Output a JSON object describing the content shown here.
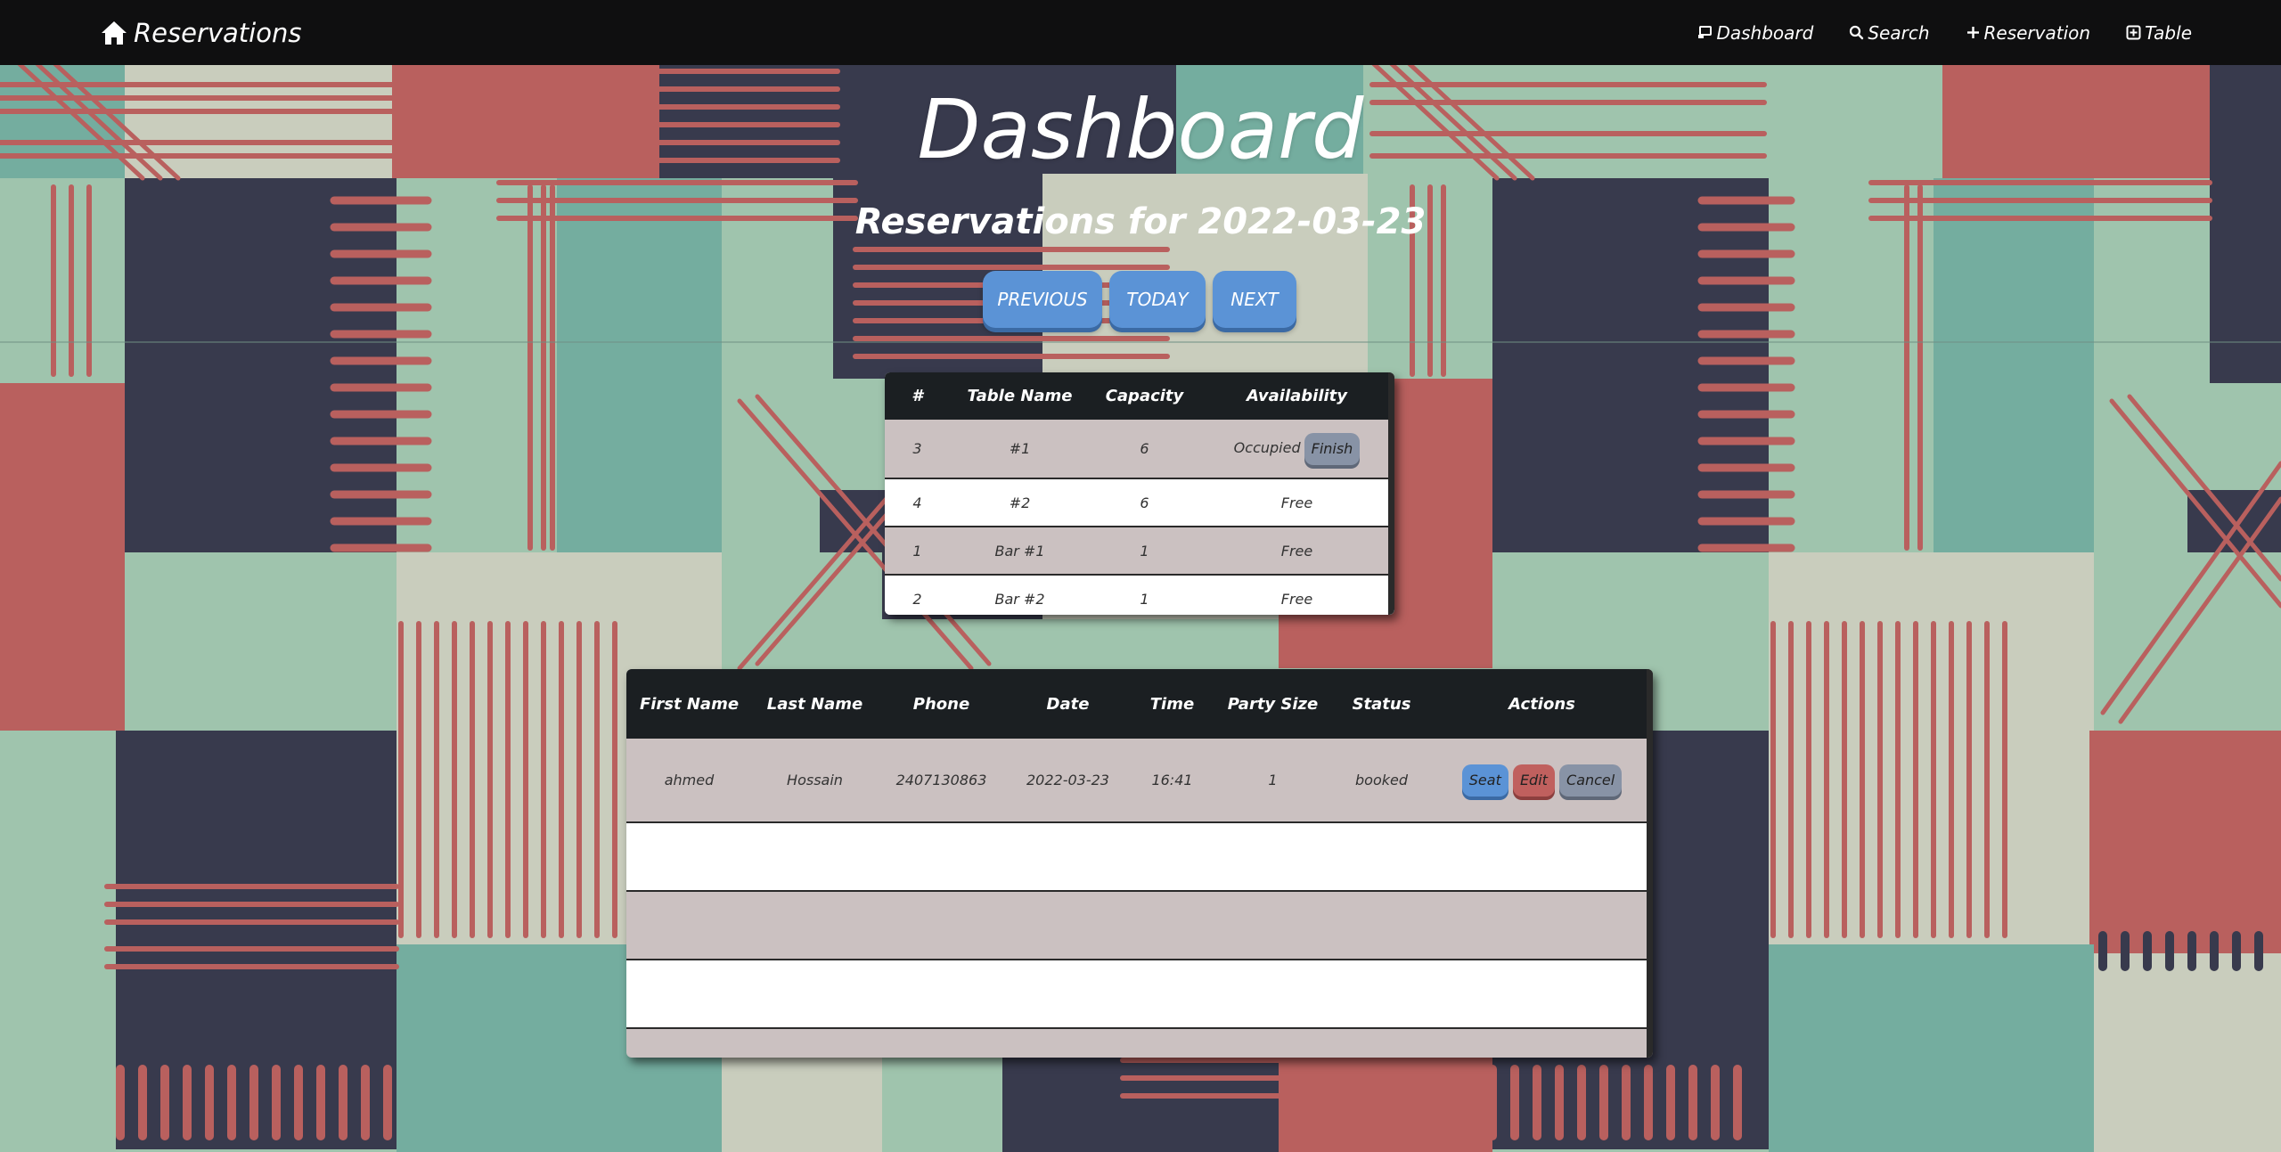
{
  "navbar": {
    "brand": "Reservations",
    "links": [
      {
        "label": "Dashboard",
        "icon": "dashboard-icon"
      },
      {
        "label": "Search",
        "icon": "search-icon"
      },
      {
        "label": "Reservation",
        "icon": "plus-icon"
      },
      {
        "label": "Table",
        "icon": "plus-square-icon"
      }
    ]
  },
  "page": {
    "title": "Dashboard",
    "subtitle": "Reservations for 2022-03-23"
  },
  "date_buttons": {
    "previous": "PREVIOUS",
    "today": "TODAY",
    "next": "NEXT"
  },
  "tables_table": {
    "headers": [
      "#",
      "Table Name",
      "Capacity",
      "Availability"
    ],
    "rows": [
      {
        "id": "3",
        "name": "#1",
        "capacity": "6",
        "availability": "Occupied",
        "action": "Finish"
      },
      {
        "id": "4",
        "name": "#2",
        "capacity": "6",
        "availability": "Free"
      },
      {
        "id": "1",
        "name": "Bar #1",
        "capacity": "1",
        "availability": "Free"
      },
      {
        "id": "2",
        "name": "Bar #2",
        "capacity": "1",
        "availability": "Free"
      }
    ]
  },
  "reservations_table": {
    "headers": [
      "First Name",
      "Last Name",
      "Phone",
      "Date",
      "Time",
      "Party Size",
      "Status",
      "Actions"
    ],
    "rows": [
      {
        "first_name": "ahmed",
        "last_name": "Hossain",
        "phone": "2407130863",
        "date": "2022-03-23",
        "time": "16:41",
        "party_size": "1",
        "status": "booked",
        "actions": {
          "seat": "Seat",
          "edit": "Edit",
          "cancel": "Cancel"
        }
      }
    ]
  },
  "colors": {
    "navbar": "#0f0f10",
    "primary_button": "#5b93d6",
    "danger_button": "#c0605e",
    "secondary_button": "#8893a6",
    "table_header": "#1b1f22",
    "row_shade": "#cbc1c1",
    "pattern_red": "#b9605e",
    "pattern_navy": "#383a4d",
    "pattern_teal": "#74ad9f",
    "pattern_mint": "#9fc4ad",
    "pattern_cream": "#c9cdbd"
  }
}
